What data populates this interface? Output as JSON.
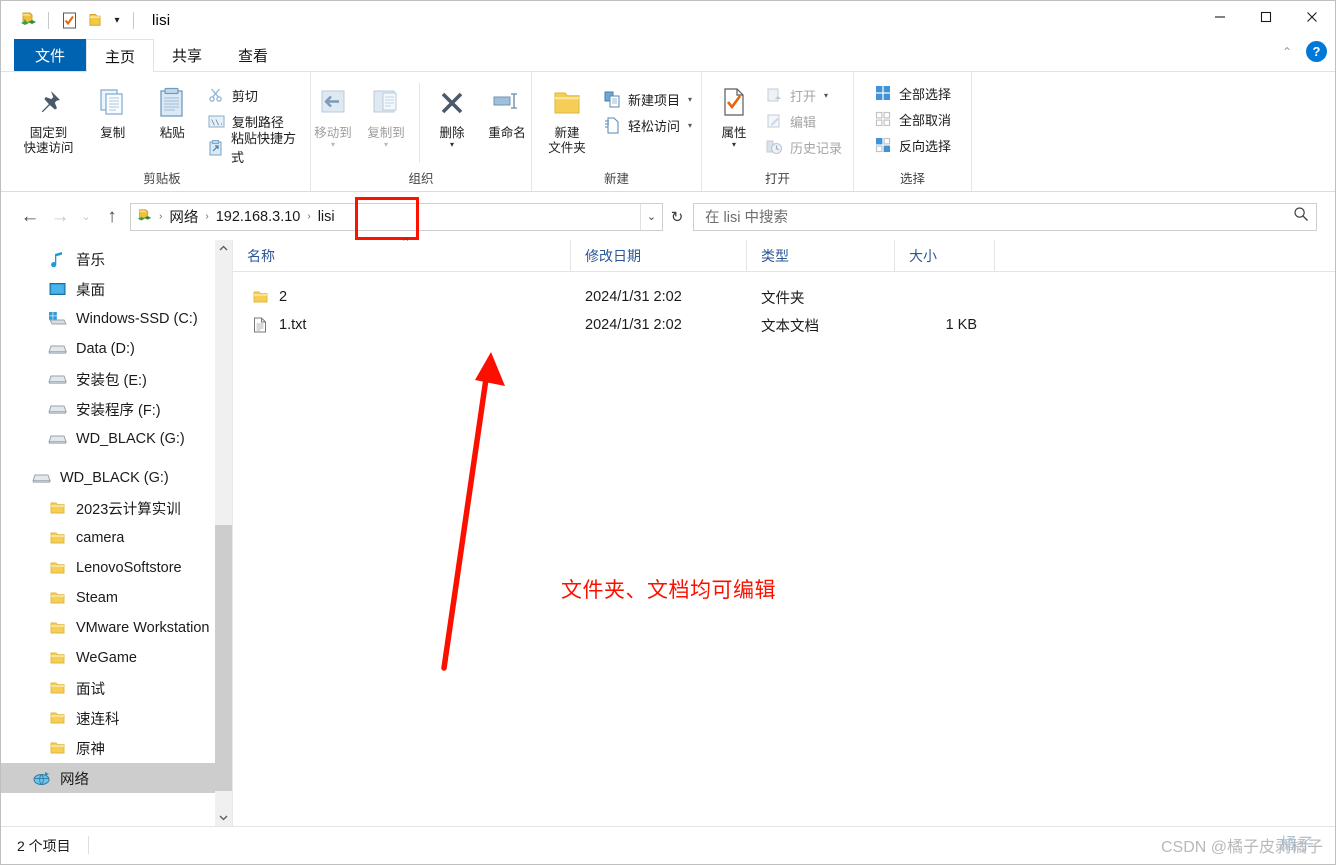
{
  "window": {
    "title": "lisi",
    "minimize_label": "─",
    "maximize_label": "□",
    "close_label": "✕",
    "collapse_ribbon_label": "⌃",
    "help_label": "?"
  },
  "quick_access": {
    "items": [
      {
        "name": "network-folder-icon",
        "label": ""
      },
      {
        "name": "properties-icon",
        "label": ""
      },
      {
        "name": "new-folder-icon",
        "label": ""
      }
    ],
    "dropdown_label": "▾"
  },
  "tabs": [
    {
      "id": "file",
      "label": "文件"
    },
    {
      "id": "home",
      "label": "主页"
    },
    {
      "id": "share",
      "label": "共享"
    },
    {
      "id": "view",
      "label": "查看"
    }
  ],
  "ribbon": {
    "groups": [
      {
        "id": "clipboard",
        "caption": "剪贴板",
        "big": [
          {
            "label": "固定到\n快速访问",
            "icon": "pin-icon"
          },
          {
            "label": "复制",
            "icon": "copy-icon"
          },
          {
            "label": "粘贴",
            "icon": "paste-icon"
          }
        ],
        "small": [
          {
            "label": "剪切",
            "icon": "scissors-icon",
            "disabled": false
          },
          {
            "label": "复制路径",
            "icon": "copy-path-icon",
            "disabled": false
          },
          {
            "label": "粘贴快捷方式",
            "icon": "paste-shortcut-icon",
            "disabled": false
          }
        ]
      },
      {
        "id": "organize",
        "caption": "组织",
        "big": [
          {
            "label": "移动到",
            "icon": "move-to-icon",
            "disabled": true,
            "caret": true
          },
          {
            "label": "复制到",
            "icon": "copy-to-icon",
            "disabled": true,
            "caret": true
          },
          {
            "label": "删除",
            "icon": "delete-icon",
            "disabled": false,
            "caret": true
          },
          {
            "label": "重命名",
            "icon": "rename-icon",
            "disabled": false
          }
        ],
        "small": []
      },
      {
        "id": "new",
        "caption": "新建",
        "big": [
          {
            "label": "新建\n文件夹",
            "icon": "new-folder-big-icon"
          }
        ],
        "small": [
          {
            "label": "新建项目",
            "icon": "new-item-icon",
            "dropdown": true
          },
          {
            "label": "轻松访问",
            "icon": "easy-access-icon",
            "dropdown": true
          }
        ]
      },
      {
        "id": "open",
        "caption": "打开",
        "big": [
          {
            "label": "属性",
            "icon": "properties-big-icon",
            "caret": true
          }
        ],
        "small": [
          {
            "label": "打开",
            "icon": "open-icon",
            "disabled": true,
            "dropdown": true
          },
          {
            "label": "编辑",
            "icon": "edit-icon",
            "disabled": true
          },
          {
            "label": "历史记录",
            "icon": "history-icon",
            "disabled": true
          }
        ]
      },
      {
        "id": "select",
        "caption": "选择",
        "big": [],
        "small": [
          {
            "label": "全部选择",
            "icon": "select-all-icon"
          },
          {
            "label": "全部取消",
            "icon": "select-none-icon"
          },
          {
            "label": "反向选择",
            "icon": "invert-selection-icon"
          }
        ]
      }
    ]
  },
  "addressbar": {
    "back_label": "←",
    "forward_label": "→",
    "recent_label": "⌄",
    "up_label": "↑",
    "crumbs": [
      "网络",
      "192.168.3.10",
      "lisi"
    ],
    "separator": "›",
    "dropdown_label": "⌄",
    "refresh_label": "↻"
  },
  "search": {
    "placeholder": "在 lisi 中搜索",
    "icon": "search-icon"
  },
  "sidebar": {
    "items": [
      {
        "label": "音乐",
        "icon": "music-icon",
        "level": 2,
        "selected": false
      },
      {
        "label": "桌面",
        "icon": "desktop-icon",
        "level": 2,
        "selected": false
      },
      {
        "label": "Windows-SSD (C:)",
        "icon": "windows-drive-icon",
        "level": 2,
        "selected": false
      },
      {
        "label": "Data (D:)",
        "icon": "drive-icon",
        "level": 2,
        "selected": false
      },
      {
        "label": "安装包 (E:)",
        "icon": "drive-icon",
        "level": 2,
        "selected": false
      },
      {
        "label": "安装程序 (F:)",
        "icon": "drive-icon",
        "level": 2,
        "selected": false
      },
      {
        "label": "WD_BLACK (G:)",
        "icon": "drive-icon",
        "level": 2,
        "selected": false
      },
      {
        "label": "WD_BLACK (G:)",
        "icon": "drive-icon",
        "level": 1,
        "selected": false,
        "spacer_before": true
      },
      {
        "label": "2023云计算实训",
        "icon": "folder-icon",
        "level": 2,
        "selected": false
      },
      {
        "label": "camera",
        "icon": "folder-icon",
        "level": 2,
        "selected": false
      },
      {
        "label": "LenovoSoftstore",
        "icon": "folder-icon",
        "level": 2,
        "selected": false
      },
      {
        "label": "Steam",
        "icon": "folder-icon",
        "level": 2,
        "selected": false
      },
      {
        "label": "VMware Workstation",
        "icon": "folder-icon",
        "level": 2,
        "selected": false
      },
      {
        "label": "WeGame",
        "icon": "folder-icon",
        "level": 2,
        "selected": false
      },
      {
        "label": "面试",
        "icon": "folder-icon",
        "level": 2,
        "selected": false
      },
      {
        "label": "速连科",
        "icon": "folder-icon",
        "level": 2,
        "selected": false
      },
      {
        "label": "原神",
        "icon": "folder-icon",
        "level": 2,
        "selected": false
      },
      {
        "label": "网络",
        "icon": "network-icon",
        "level": 1,
        "selected": true
      }
    ]
  },
  "filelist": {
    "columns": [
      {
        "key": "name",
        "label": "名称"
      },
      {
        "key": "date",
        "label": "修改日期"
      },
      {
        "key": "type",
        "label": "类型"
      },
      {
        "key": "size",
        "label": "大小"
      }
    ],
    "sort_indicator": "⌃",
    "rows": [
      {
        "name": "2",
        "date": "2024/1/31 2:02",
        "type": "文件夹",
        "size": "",
        "icon": "folder-icon"
      },
      {
        "name": "1.txt",
        "date": "2024/1/31 2:02",
        "type": "文本文档",
        "size": "1 KB",
        "icon": "text-file-icon"
      }
    ]
  },
  "annotations": {
    "text": "文件夹、文档均可编辑",
    "color": "#fb1000",
    "arrow_name": "red-arrow-annotation",
    "highlight_box_name": "red-highlight-box"
  },
  "statusbar": {
    "item_count": "2 个项目"
  },
  "watermark": {
    "text": "CSDN @橘子皮剥橘子",
    "overlay": "橘子"
  },
  "colors": {
    "accent": "#0063b1",
    "help_blue": "#0078d7",
    "annotation_red": "#fb1000",
    "column_header": "#2b5797",
    "selection_gray": "#cdcdcd"
  }
}
